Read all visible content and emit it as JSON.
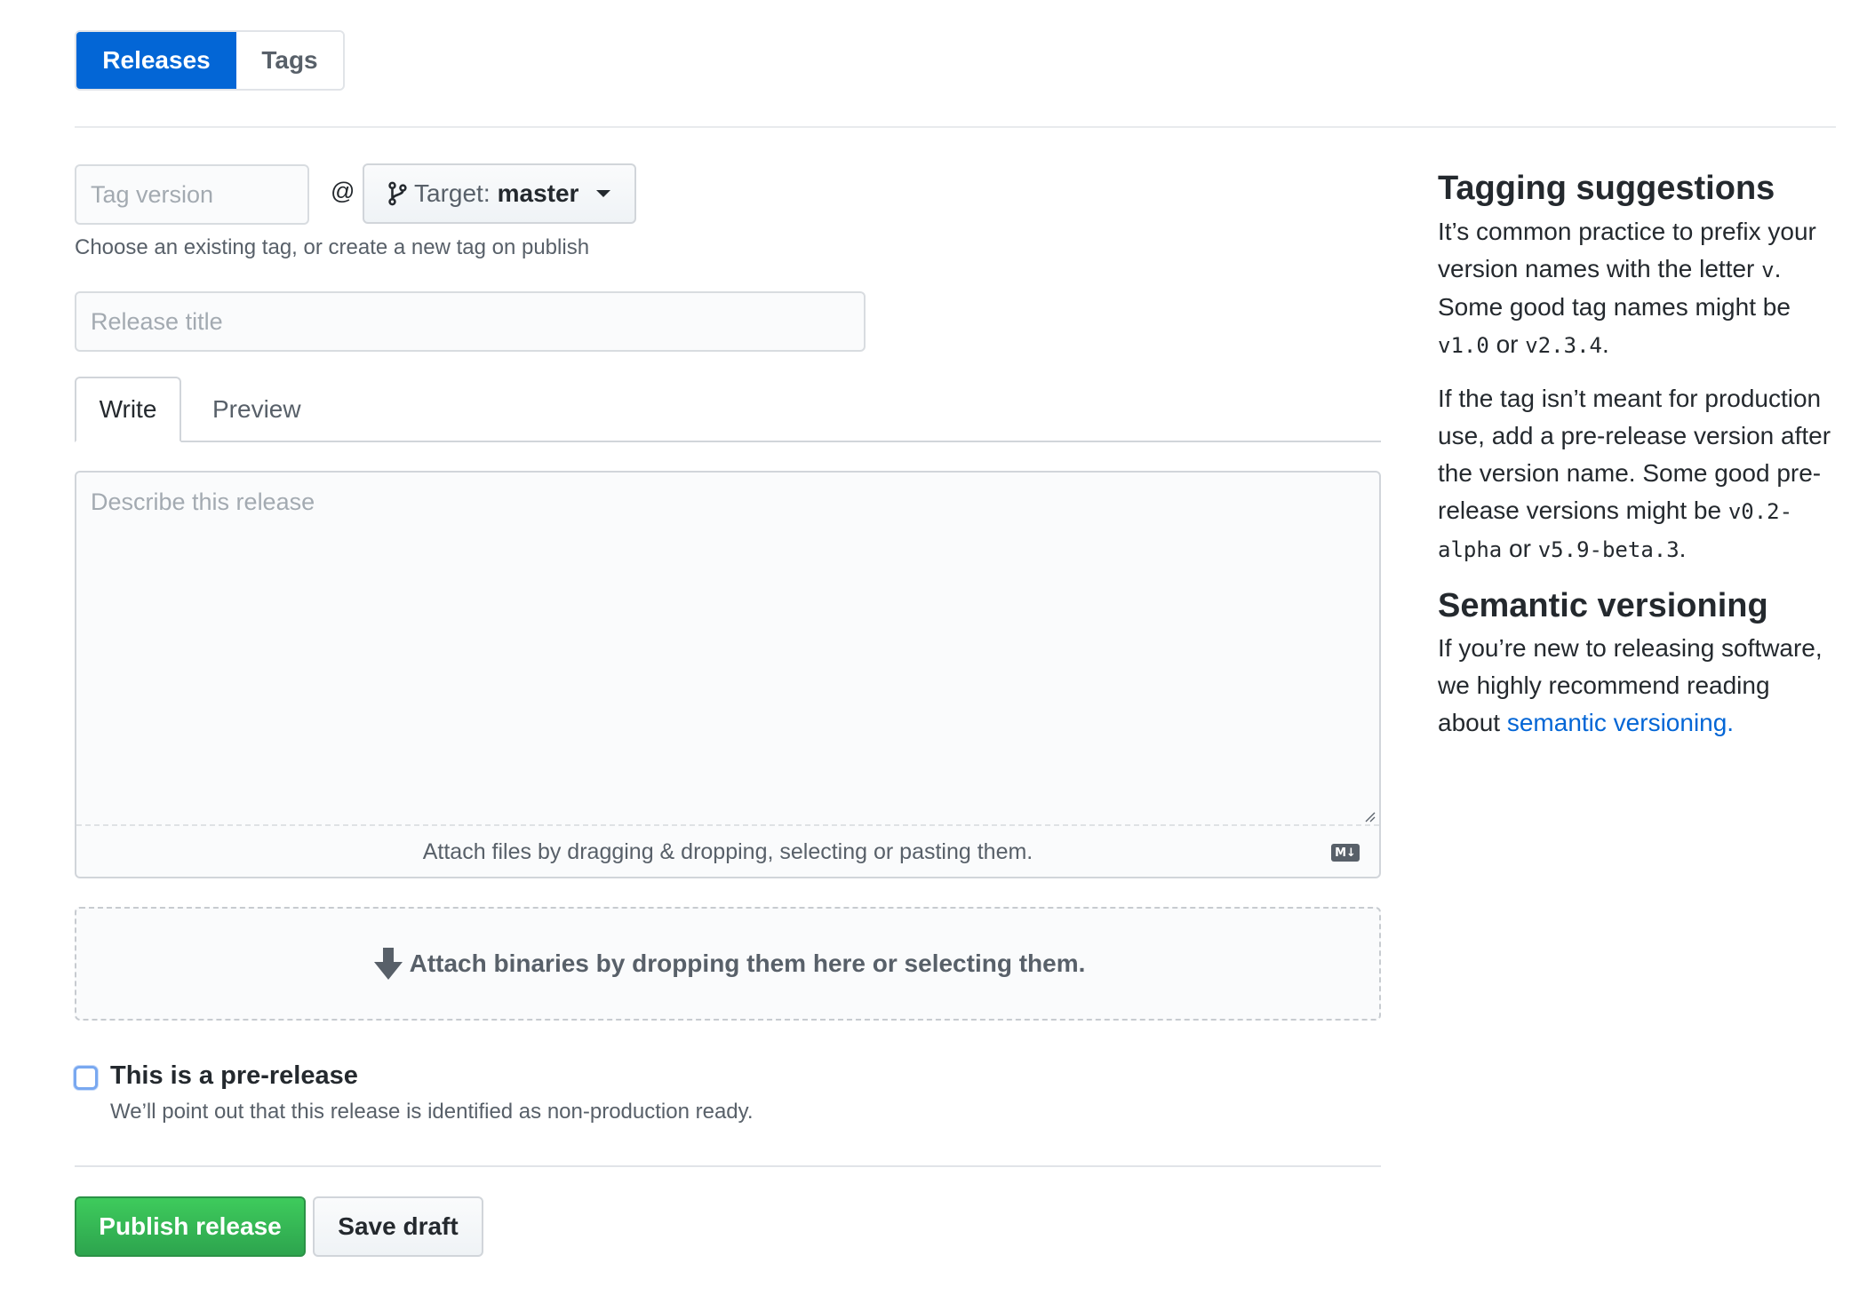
{
  "nav": {
    "segments": [
      {
        "label": "Releases",
        "active": true
      },
      {
        "label": "Tags",
        "active": false
      }
    ]
  },
  "form": {
    "tag_input": {
      "value": "",
      "placeholder": "Tag version"
    },
    "at_symbol": "@",
    "target": {
      "prefix": "Target:",
      "value": "master"
    },
    "tag_helper": "Choose an existing tag, or create a new tag on publish",
    "title_input": {
      "value": "",
      "placeholder": "Release title"
    },
    "tabs": [
      {
        "label": "Write",
        "active": true
      },
      {
        "label": "Preview",
        "active": false
      }
    ],
    "description": {
      "value": "",
      "placeholder": "Describe this release"
    },
    "attach_files_text": "Attach files by dragging & dropping, selecting or pasting them.",
    "markdown_badge": "M↓",
    "binaries_text": "Attach binaries by dropping them here or selecting them.",
    "prerelease": {
      "checked": false,
      "label": "This is a pre-release",
      "note": "We’ll point out that this release is identified as non-production ready."
    },
    "buttons": {
      "publish": "Publish release",
      "save_draft": "Save draft"
    }
  },
  "sidebar": {
    "tagging": {
      "heading": "Tagging suggestions",
      "p1_text1": "It’s common practice to prefix your version names with the letter ",
      "p1_code1": "v",
      "p1_text2": ". Some good tag names might be ",
      "p1_code2": "v1.0",
      "p1_text3": " or ",
      "p1_code3": "v2.3.4",
      "p1_text4": ".",
      "p2_text1": "If the tag isn’t meant for production use, add a pre-release version after the version name. Some good pre-release versions might be ",
      "p2_code1": "v0.2-alpha",
      "p2_text2": " or ",
      "p2_code2": "v5.9-beta.3",
      "p2_text3": "."
    },
    "semver": {
      "heading": "Semantic versioning",
      "text": "If you’re new to releasing software, we highly recommend reading about ",
      "link": "semantic versioning."
    }
  },
  "colors": {
    "primary_blue": "#0366d6",
    "publish_green": "#2ea44f",
    "text": "#24292e",
    "muted": "#586069"
  }
}
